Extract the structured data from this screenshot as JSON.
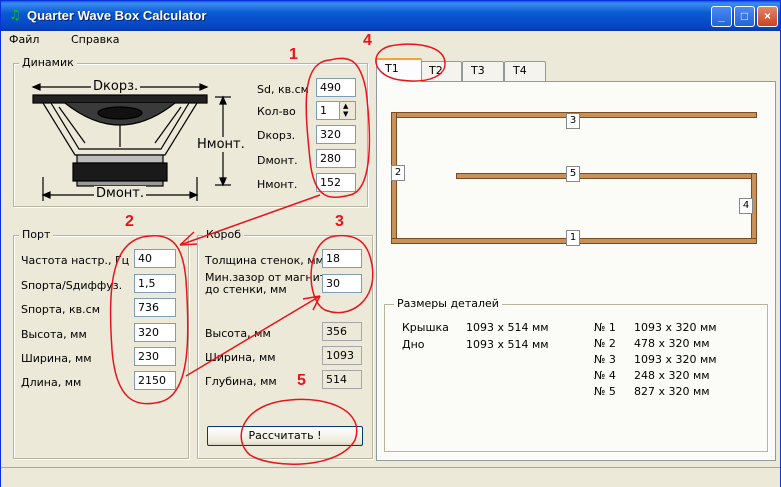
{
  "window": {
    "title": "Quarter Wave Box Calculator",
    "minimize": "_",
    "maximize": "□",
    "close": "×"
  },
  "menu": [
    "Файл",
    "Справка"
  ],
  "driver": {
    "legend": "Динамик",
    "dim_dkorp": "Dкорз.",
    "dim_hmont": "Нмонт.",
    "dim_dmont": "Dмонт.",
    "fields": [
      {
        "label": "Sd, кв.см",
        "value": "490"
      },
      {
        "label": "Кол-во",
        "value": "1"
      },
      {
        "label": "Dкорз.",
        "value": "320"
      },
      {
        "label": "Dмонт.",
        "value": "280"
      },
      {
        "label": "Нмонт.",
        "value": "152"
      }
    ]
  },
  "port": {
    "legend": "Порт",
    "fields": [
      {
        "label": "Частота настр., Гц",
        "value": "40"
      },
      {
        "label": "Sпорта/Sдиффуз.",
        "value": "1,5"
      },
      {
        "label": "Sпорта, кв.см",
        "value": "736"
      },
      {
        "label": "Высота, мм",
        "value": "320"
      },
      {
        "label": "Ширина, мм",
        "value": "230"
      },
      {
        "label": "Длина, мм",
        "value": "2150"
      }
    ]
  },
  "box": {
    "legend": "Короб",
    "wall_label": "Толщина стенок, мм",
    "wall_value": "18",
    "gap_label_1": "Мин.зазор от магнита",
    "gap_label_2": "до стенки, мм",
    "gap_value": "30",
    "height_label": "Высота, мм",
    "height_value": "356",
    "width_label": "Ширина, мм",
    "width_value": "1093",
    "depth_label": "Глубина, мм",
    "depth_value": "514",
    "calc_button": "Рассчитать !"
  },
  "tabs": [
    "T1",
    "T2",
    "T3",
    "T4"
  ],
  "diagram_labels": [
    "3",
    "2",
    "5",
    "4",
    "1"
  ],
  "parts": {
    "legend": "Размеры деталей",
    "left": [
      {
        "name": "Крышка",
        "size": "1093 x 514 мм"
      },
      {
        "name": "Дно",
        "size": "1093 x 514 мм"
      }
    ],
    "right": [
      {
        "name": "№ 1",
        "size": "1093 x 320 мм"
      },
      {
        "name": "№ 2",
        "size": "478 x 320 мм"
      },
      {
        "name": "№ 3",
        "size": "1093 x 320 мм"
      },
      {
        "name": "№ 4",
        "size": "248 x 320 мм"
      },
      {
        "name": "№ 5",
        "size": "827 x 320 мм"
      }
    ]
  },
  "annotations": [
    "1",
    "2",
    "3",
    "4",
    "5"
  ],
  "colors": {
    "annotation": "#e8141b",
    "plank": "#c8905a",
    "title_bar": "#0a5ad2"
  }
}
